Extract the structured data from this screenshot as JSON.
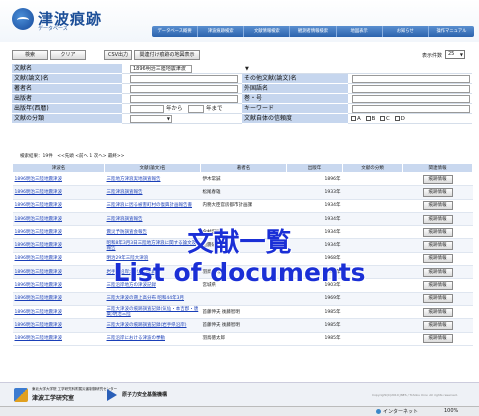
{
  "header": {
    "logo_title": "津波痕跡",
    "logo_subtitle": "データベース",
    "nav": [
      "データベース概要",
      "津波痕跡検索",
      "文献情報検索",
      "観測者情報検索",
      "地図表示",
      "お知らせ",
      "操作マニュアル"
    ]
  },
  "toolbar": {
    "search_label": "検索",
    "clear_label": "クリア",
    "csv_label": "CSV出力",
    "map_label": "関連付け痕跡の地図表示",
    "display_count_label": "表示件数",
    "display_count_value": "25"
  },
  "form": {
    "doc_name_label": "文献名",
    "doc_name_value": "1896明治三陸地震津波",
    "doc_name_en_label": "文献(論文)名",
    "other_doc_label": "その他文献(論文)名",
    "author_label": "著者名",
    "foreign_doc_label": "外国語名",
    "publisher_label": "出版者",
    "volume_label": "巻・号",
    "year_label": "出版年(西暦)",
    "year_from": "年から",
    "year_to": "年まで",
    "keyword_label": "キーワード",
    "category_label": "文献の分類",
    "reliability_label": "文献自体の信頼度",
    "reliability_options": [
      "A",
      "B",
      "C",
      "D"
    ]
  },
  "results": {
    "summary": "検索結果：19件　<<先頭 <前へ 1 次へ> 最終>>",
    "columns": [
      "津波名",
      "文献(論文)名",
      "著者名",
      "出版年",
      "文献の分類",
      "関連情報"
    ],
    "detail_label": "痕跡情報",
    "rows": [
      {
        "tsunami": "1896明治三陸地震津波",
        "doc": "三陸地方津浪実地調査報告",
        "author": "伊木常誠",
        "year": "1896年",
        "category": ""
      },
      {
        "tsunami": "1896明治三陸地震津波",
        "doc": "三陸津浪調査報告",
        "author": "松尾春雄",
        "year": "1933年",
        "category": ""
      },
      {
        "tsunami": "1896明治三陸地震津波",
        "doc": "三陸津浪に因る被害町村の復興計画報告書",
        "author": "内務大臣官房都市計画課",
        "year": "1934年",
        "category": ""
      },
      {
        "tsunami": "1896明治三陸地震津波",
        "doc": "三陸津浪調査報告",
        "author": "",
        "year": "1934年",
        "category": ""
      },
      {
        "tsunami": "1896明治三陸地震津波",
        "doc": "震災予防調査会報告",
        "author": "今村明恒",
        "year": "1934年",
        "category": ""
      },
      {
        "tsunami": "1896明治三陸地震津波",
        "doc": "昭和8年3月3日三陸地方津浪に関する論文及報告",
        "author": "地震研究所",
        "year": "1934年",
        "category": ""
      },
      {
        "tsunami": "1896明治三陸地震津波",
        "doc": "明治29年三陸大津浪",
        "author": "",
        "year": "1968年",
        "category": ""
      },
      {
        "tsunami": "1896明治三陸地震津波",
        "doc": "岩手県沿岸大津波の記録",
        "author": "羽鳥徳太郎",
        "year": "1969年",
        "category": ""
      },
      {
        "tsunami": "1896明治三陸地震津波",
        "doc": "三陸沿岸地方の津波記録",
        "author": "宮城県",
        "year": "1903年",
        "category": ""
      },
      {
        "tsunami": "1896明治三陸地震津波",
        "doc": "三陸大津波の遡上高分布 昭和44年3月",
        "author": "",
        "year": "1969年",
        "category": ""
      },
      {
        "tsunami": "1896明治三陸地震津波",
        "doc": "三陸大津波の痕跡調査記録(気仙・本吉郡・唐桑)明治三陸",
        "author": "首藤伸夫 後藤智明",
        "year": "1985年",
        "category": ""
      },
      {
        "tsunami": "1896明治三陸地震津波",
        "doc": "三陸大津波の痕跡調査記録(岩手県沿岸)",
        "author": "首藤伸夫 後藤智明",
        "year": "1985年",
        "category": ""
      },
      {
        "tsunami": "1896明治三陸地震津波",
        "doc": "三陸沿岸における津波の挙動",
        "author": "羽鳥徳太郎",
        "year": "1985年",
        "category": ""
      }
    ]
  },
  "overlay": {
    "title_jp": "文献一覧",
    "title_en": "List of documents"
  },
  "footer": {
    "org1_small": "東北大学大学院 工学研究科附属災害制御研究センター",
    "org1_name": "津波工学研究室",
    "org2_name": "原子力安全基盤機構",
    "copyright": "Copyright(C)2010 JNES / Tohoku Univ. All rights reserved."
  },
  "statusbar": {
    "zone": "インターネット",
    "zoom": "100%"
  },
  "colors": {
    "label_bg": "#c6d6ee",
    "nav_bg": "#2c63ad",
    "link": "#1a3fb8",
    "overlay_text": "#1a2fd6"
  }
}
